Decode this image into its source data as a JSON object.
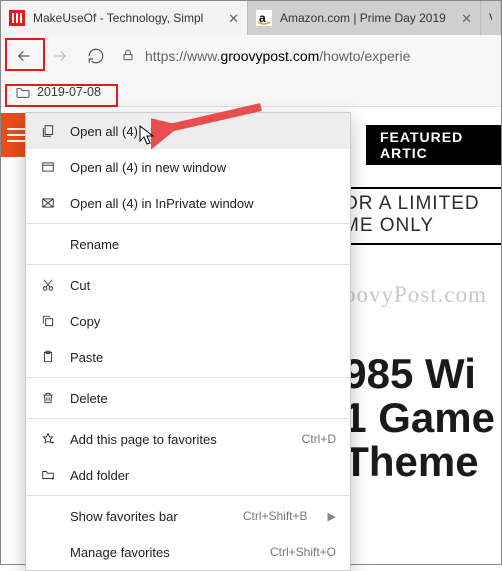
{
  "tabs": [
    {
      "title": "MakeUseOf - Technology, Simpl",
      "favicon_color": "#e31b1b"
    },
    {
      "title": "Amazon.com | Prime Day 2019"
    },
    {
      "partial": "V"
    }
  ],
  "url": {
    "prefix": "https://www.",
    "host": "groovypost.com",
    "path": "/howto/experie"
  },
  "favorites_bar": {
    "folder_label": "2019-07-08"
  },
  "context_menu": {
    "groups": [
      [
        {
          "icon": "stack-icon",
          "label": "Open all (4)",
          "hover": true
        },
        {
          "icon": "window-icon",
          "label": "Open all (4) in new window"
        },
        {
          "icon": "inprivate-icon",
          "label": "Open all (4) in InPrivate window"
        }
      ],
      [
        {
          "icon": "",
          "label": "Rename"
        }
      ],
      [
        {
          "icon": "cut-icon",
          "label": "Cut"
        },
        {
          "icon": "copy-icon",
          "label": "Copy"
        },
        {
          "icon": "paste-icon",
          "label": "Paste"
        }
      ],
      [
        {
          "icon": "delete-icon",
          "label": "Delete"
        }
      ],
      [
        {
          "icon": "star-plus-icon",
          "label": "Add this page to favorites",
          "shortcut": "Ctrl+D"
        },
        {
          "icon": "folder-plus-icon",
          "label": "Add folder"
        }
      ],
      [
        {
          "icon": "",
          "label": "Show favorites bar",
          "shortcut": "Ctrl+Shift+B",
          "submenu": true
        },
        {
          "icon": "",
          "label": "Manage favorites",
          "shortcut": "Ctrl+Shift+O"
        }
      ]
    ]
  },
  "page": {
    "featured_label": "FEATURED ARTIC",
    "promo_line1": "OR A LIMITED",
    "promo_line2": "ME ONLY",
    "watermark": "groovyPost.com",
    "headline_l1": "985 Wi",
    "headline_l2": "1 Game",
    "headline_l3": "Theme"
  }
}
